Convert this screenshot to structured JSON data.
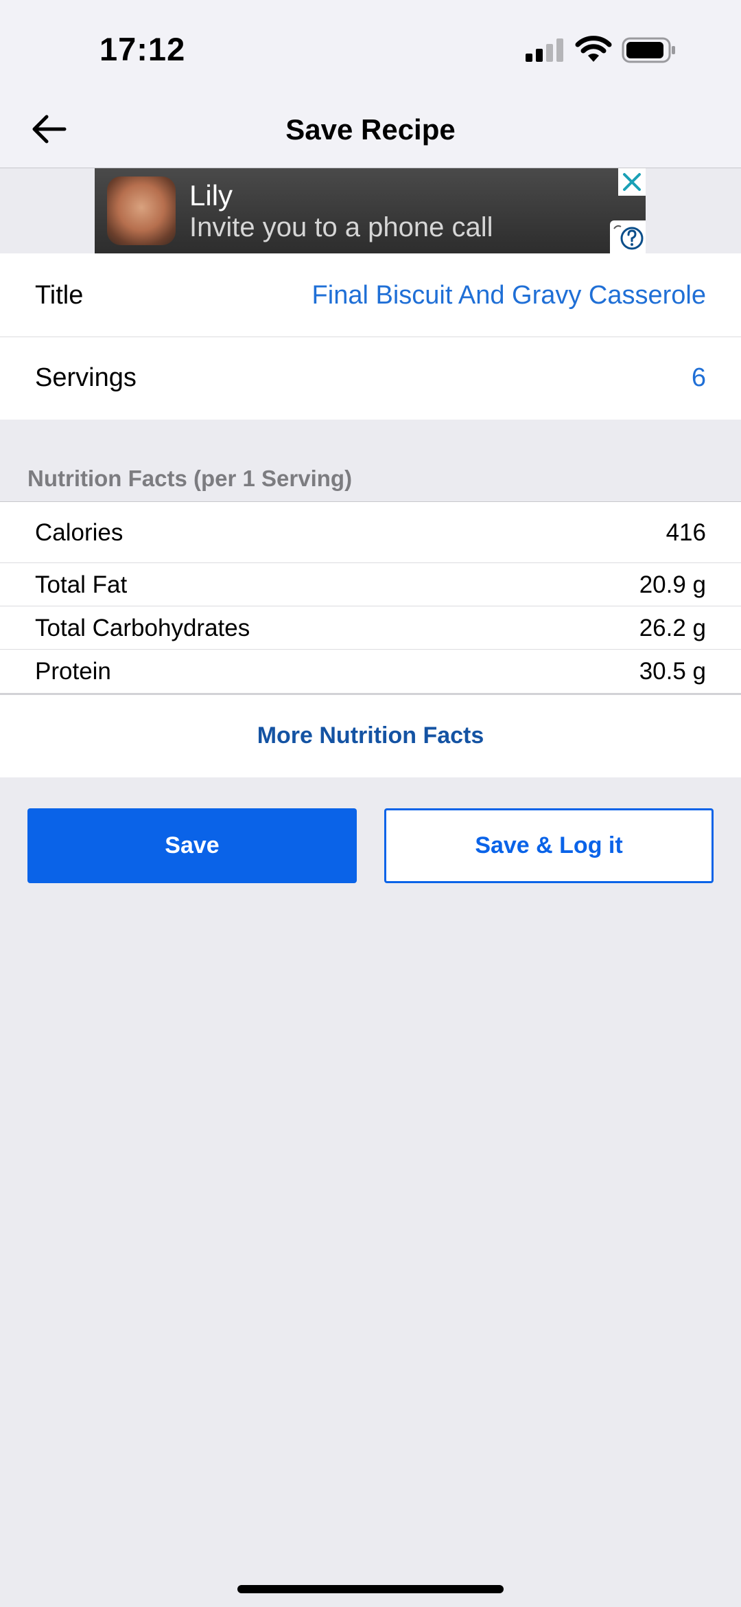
{
  "status_bar": {
    "time": "17:12"
  },
  "nav": {
    "title": "Save Recipe"
  },
  "ad": {
    "name": "Lily",
    "text": "Invite you to a phone call"
  },
  "recipe": {
    "title_label": "Title",
    "title_value": "Final Biscuit And Gravy Casserole",
    "servings_label": "Servings",
    "servings_value": "6"
  },
  "nutrition": {
    "header": "Nutrition Facts (per 1 Serving)",
    "rows": [
      {
        "label": "Calories",
        "value": "416"
      },
      {
        "label": "Total Fat",
        "value": "20.9 g"
      },
      {
        "label": "Total Carbohydrates",
        "value": "26.2 g"
      },
      {
        "label": "Protein",
        "value": "30.5 g"
      }
    ],
    "more_label": "More Nutrition Facts"
  },
  "actions": {
    "save_label": "Save",
    "save_log_label": "Save & Log it"
  },
  "colors": {
    "accent": "#0a63e8",
    "link": "#1f6fd6",
    "background": "#ebebf0"
  }
}
